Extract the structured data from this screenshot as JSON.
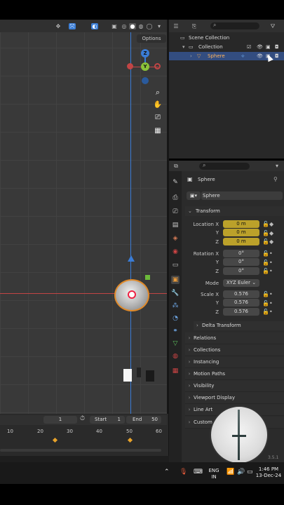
{
  "viewport": {
    "options_label": "Options",
    "gizmo": {
      "z": "Z",
      "y": "Y"
    }
  },
  "outliner": {
    "scene_collection": "Scene Collection",
    "collection": "Collection",
    "sphere": "Sphere"
  },
  "properties": {
    "object_name_header": "Sphere",
    "object_name_field": "Sphere",
    "transform_header": "Transform",
    "location": {
      "label": "Location X",
      "y_label": "Y",
      "z_label": "Z",
      "x": "0 m",
      "y": "0 m",
      "z": "0 m"
    },
    "rotation": {
      "label": "Rotation X",
      "y_label": "Y",
      "z_label": "Z",
      "x": "0°",
      "y": "0°",
      "z": "0°"
    },
    "mode": {
      "label": "Mode",
      "value": "XYZ Euler"
    },
    "scale": {
      "label": "Scale X",
      "y_label": "Y",
      "z_label": "Z",
      "x": "0.576",
      "y": "0.576",
      "z": "0.576"
    },
    "delta_transform": "Delta Transform",
    "panels": [
      "Relations",
      "Collections",
      "Instancing",
      "Motion Paths",
      "Visibility",
      "Viewport Display",
      "Line Art",
      "Custom"
    ]
  },
  "timeline": {
    "current_frame": "1",
    "start_label": "Start",
    "start_value": "1",
    "end_label": "End",
    "end_value": "50",
    "ticks": [
      "10",
      "20",
      "30",
      "40",
      "50",
      "60"
    ]
  },
  "version": "3.5.1",
  "taskbar": {
    "language": "ENG",
    "region": "IN",
    "time": "1:46 PM",
    "date": "13-Dec-24"
  },
  "colors": {
    "accent_yellow": "#bba12a",
    "selected_row": "#334d80",
    "axis_red": "#c24545",
    "axis_blue": "#3a7cd6",
    "axis_green": "#8bc23a"
  }
}
